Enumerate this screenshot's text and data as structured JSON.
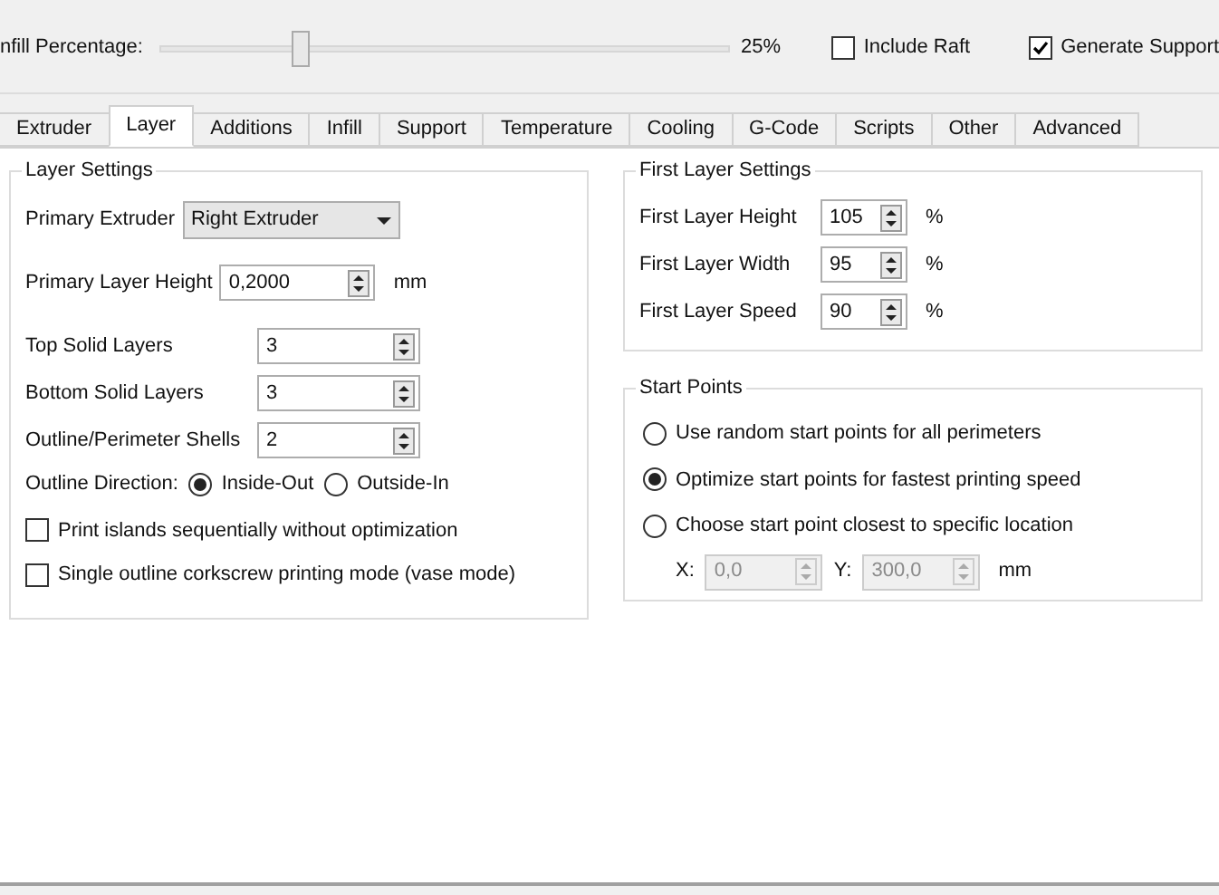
{
  "general": {
    "infill": {
      "label": "nfill Percentage:",
      "level": 0.25,
      "reading": "25%"
    },
    "checks": [
      {
        "label": "Include Raft",
        "checked": false
      },
      {
        "label": "Generate Support",
        "checked": true
      }
    ]
  },
  "tabs": [
    {
      "label": "Extruder",
      "selected": false
    },
    {
      "label": "Layer",
      "selected": true
    },
    {
      "label": "Additions",
      "selected": false
    },
    {
      "label": "Infill",
      "selected": false
    },
    {
      "label": "Support",
      "selected": false
    },
    {
      "label": "Temperature",
      "selected": false
    },
    {
      "label": "Cooling",
      "selected": false
    },
    {
      "label": "G-Code",
      "selected": false
    },
    {
      "label": "Scripts",
      "selected": false
    },
    {
      "label": "Other",
      "selected": false
    },
    {
      "label": "Advanced",
      "selected": false
    }
  ],
  "layer_settings": {
    "title": "Layer Settings",
    "primary_extruder": {
      "label": "Primary Extruder",
      "value": "Right Extruder"
    },
    "layer_height": {
      "label": "Primary Layer Height",
      "value": "0,2000",
      "unit": "mm"
    },
    "spin_rows": [
      {
        "label": "Top Solid Layers",
        "value": "3"
      },
      {
        "label": "Bottom Solid Layers",
        "value": "3"
      },
      {
        "label": "Outline/Perimeter Shells",
        "value": "2"
      }
    ],
    "direction": {
      "label": "Outline Direction:",
      "options": [
        {
          "label": "Inside-Out",
          "selected": true
        },
        {
          "label": "Outside-In",
          "selected": false
        }
      ]
    },
    "checks": [
      {
        "label": "Print islands sequentially without optimization",
        "checked": false
      },
      {
        "label": "Single outline corkscrew printing mode (vase mode)",
        "checked": false
      }
    ]
  },
  "first_layer": {
    "title": "First Layer Settings",
    "rows": [
      {
        "label": "First Layer Height",
        "value": "105",
        "unit": "%"
      },
      {
        "label": "First Layer Width",
        "value": "95",
        "unit": "%"
      },
      {
        "label": "First Layer Speed",
        "value": "90",
        "unit": "%"
      }
    ]
  },
  "start_points": {
    "title": "Start Points",
    "options": [
      {
        "label": "Use random start points for all perimeters",
        "selected": false
      },
      {
        "label": "Optimize start points for fastest printing speed",
        "selected": true
      },
      {
        "label": "Choose start point closest to specific location",
        "selected": false
      }
    ],
    "coords": [
      {
        "label": "X:",
        "value": "0,0",
        "disabled": true
      },
      {
        "label": "Y:",
        "value": "300,0",
        "disabled": true
      }
    ],
    "unit": "mm"
  }
}
